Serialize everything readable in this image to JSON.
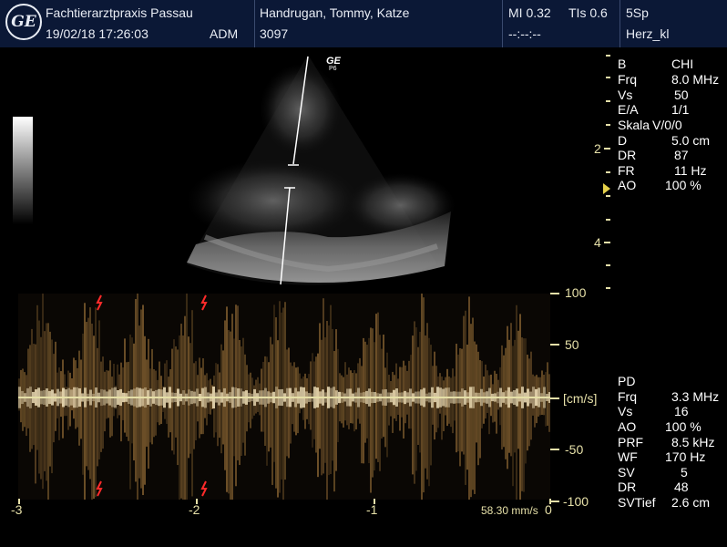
{
  "header": {
    "clinic": "Fachtierarztpraxis Passau",
    "datetime": "19/02/18 17:26:03",
    "operator": "ADM",
    "patient": "Handrugan, Tommy, Katze",
    "patient_id": "3097",
    "mi": "MI 0.32",
    "tis": "TIs 0.6",
    "time_placeholder": "--:--:--",
    "probe": "5Sp",
    "preset": "Herz_kl",
    "logo": "GE"
  },
  "probe_mark": {
    "brand": "GE",
    "sub": "P6"
  },
  "bmode_params": [
    {
      "label": "B",
      "value": "CHI"
    },
    {
      "label": "Frq",
      "value": "8.0 MHz"
    },
    {
      "label": "Vs",
      "value": "50"
    },
    {
      "label": "E/A",
      "value": "1/1"
    },
    {
      "label": "Skala",
      "value": "V/0/0"
    },
    {
      "label": "D",
      "value": "5.0 cm"
    },
    {
      "label": "DR",
      "value": "87"
    },
    {
      "label": "FR",
      "value": "11 Hz"
    },
    {
      "label": "AO",
      "value": "100 %"
    }
  ],
  "depth_scale": [
    "2",
    "4"
  ],
  "pd_params": [
    {
      "label": "PD",
      "value": ""
    },
    {
      "label": "Frq",
      "value": "3.3 MHz"
    },
    {
      "label": "Vs",
      "value": "16"
    },
    {
      "label": "AO",
      "value": "100 %"
    },
    {
      "label": "PRF",
      "value": "8.5 kHz"
    },
    {
      "label": "WF",
      "value": "170 Hz"
    },
    {
      "label": "SV",
      "value": "5"
    },
    {
      "label": "DR",
      "value": "48"
    },
    {
      "label": "SVTief",
      "value": "2.6 cm"
    }
  ],
  "velocity_scale": [
    "100",
    "50",
    "[cm/s]",
    "-50",
    "-100"
  ],
  "time_axis": [
    "-3",
    "-2",
    "-1",
    "0"
  ],
  "sweep_speed": "58.30 mm/s",
  "colors": {
    "header_bg": "#0b1836",
    "scale": "#e6e0a8",
    "ecg": "#ff2a2a"
  }
}
